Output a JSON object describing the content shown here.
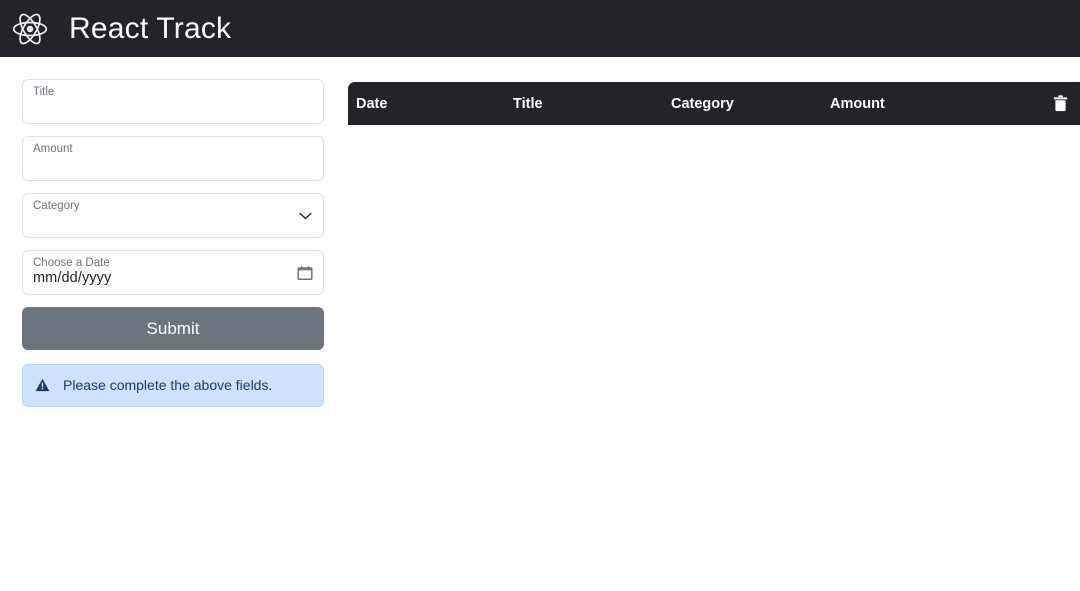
{
  "navbar": {
    "logo_icon": "react-atom-icon",
    "title": "React Track",
    "background": "#212529"
  },
  "form": {
    "fields": [
      {
        "label": "Title",
        "value": "",
        "placeholder": "",
        "type": "text"
      },
      {
        "label": "Amount",
        "value": "",
        "placeholder": "",
        "type": "text"
      },
      {
        "label": "Category",
        "value": "",
        "placeholder": "",
        "type": "select",
        "icon": "chevron-down-icon"
      },
      {
        "label": "Choose a Date",
        "value": "",
        "placeholder": "",
        "type": "date",
        "icon": "calendar-icon"
      }
    ],
    "date_placeholder": {
      "month": "mm",
      "sep1": "/",
      "day": "dd",
      "sep2": "/",
      "year": "yyyy"
    },
    "submit_label": "Submit",
    "submit_color": "#6c757d"
  },
  "alert": {
    "icon": "warning-triangle-icon",
    "message": "Please complete the above fields.",
    "background": "#cfe2ff",
    "text_color": "#1b3b6f"
  },
  "table": {
    "columns": [
      {
        "label": "Date"
      },
      {
        "label": "Title"
      },
      {
        "label": "Category"
      },
      {
        "label": "Amount"
      },
      {
        "label": "",
        "icon": "trash-icon"
      }
    ],
    "rows": [],
    "header_background": "#212529"
  }
}
